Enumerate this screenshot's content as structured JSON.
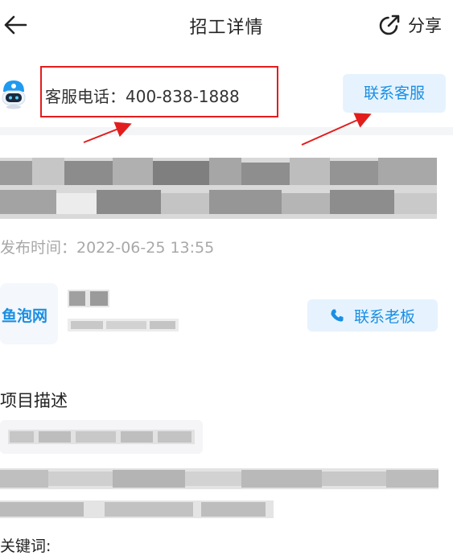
{
  "header": {
    "title": "招工详情",
    "share_label": "分享",
    "back_icon": "arrow-left-icon",
    "share_icon": "share-arrow-icon"
  },
  "customer_service": {
    "text": "客服电话：400-838-1888",
    "button_label": "联系客服",
    "avatar_icon": "robot-icon",
    "highlight_color": "#e21d1d"
  },
  "job": {
    "publish_time": "发布时间：2022-06-25 13:55"
  },
  "boss": {
    "logo_text": "鱼泡网",
    "contact_button_label": "联系老板",
    "phone_icon": "phone-icon"
  },
  "description": {
    "section_title": "项目描述",
    "keywords_label": "关键词:"
  },
  "colors": {
    "accent": "#1a8fe3",
    "button_bg": "#e6f3fe",
    "annotation_red": "#e21d1d"
  }
}
